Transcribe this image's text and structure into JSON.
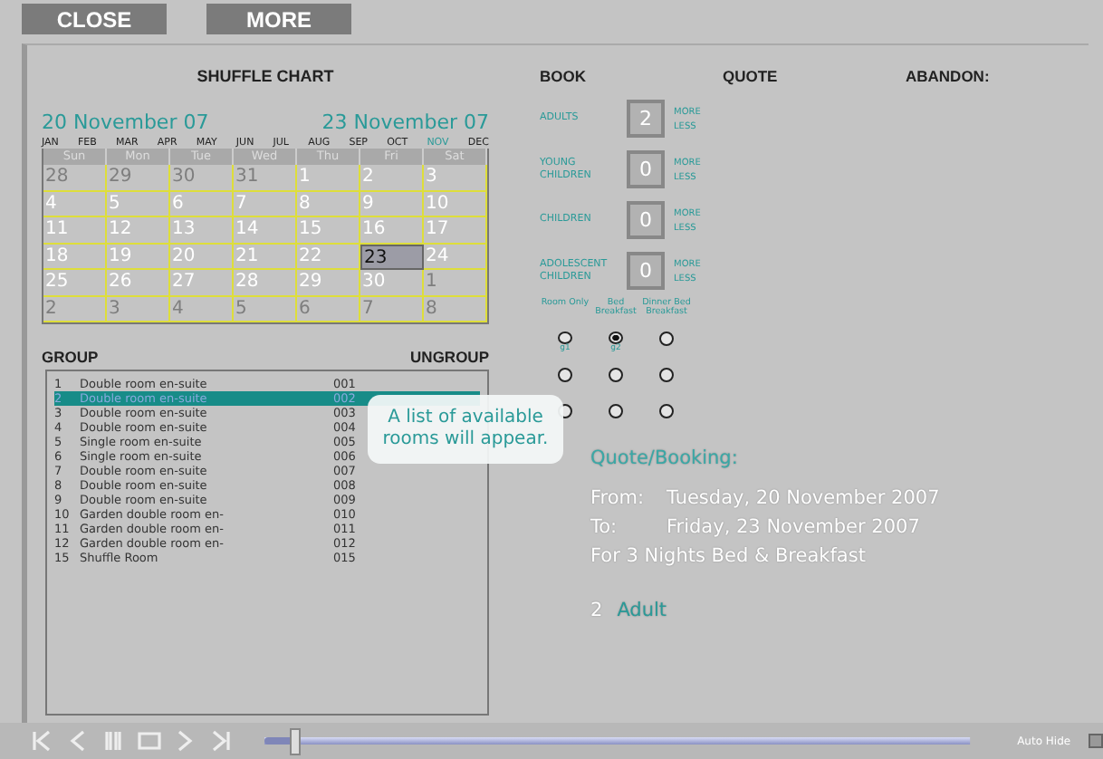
{
  "top_buttons": [
    "CLOSE",
    "MORE"
  ],
  "calendar": {
    "title": "SHUFFLE CHART",
    "from_date": "20 November 07",
    "to_date": "23 November 07",
    "months": [
      {
        "label": "JAN",
        "selected": false
      },
      {
        "label": "FEB",
        "selected": false
      },
      {
        "label": "MAR",
        "selected": false
      },
      {
        "label": "APR",
        "selected": false
      },
      {
        "label": "MAY",
        "selected": false
      },
      {
        "label": "JUN",
        "selected": false
      },
      {
        "label": "JUL",
        "selected": false
      },
      {
        "label": "AUG",
        "selected": false
      },
      {
        "label": "SEP",
        "selected": false
      },
      {
        "label": "OCT",
        "selected": false
      },
      {
        "label": "NOV",
        "selected": true
      },
      {
        "label": "DEC",
        "selected": false
      }
    ],
    "weekdays": [
      "Sun",
      "Mon",
      "Tue",
      "Wed",
      "Thu",
      "Fri",
      "Sat"
    ],
    "weeks": [
      [
        {
          "day": "28",
          "muted": true,
          "selected": false
        },
        {
          "day": "29",
          "muted": true,
          "selected": false
        },
        {
          "day": "30",
          "muted": true,
          "selected": false
        },
        {
          "day": "31",
          "muted": true,
          "selected": false
        },
        {
          "day": "1",
          "muted": false,
          "selected": false
        },
        {
          "day": "2",
          "muted": false,
          "selected": false
        },
        {
          "day": "3",
          "muted": false,
          "selected": false
        }
      ],
      [
        {
          "day": "4",
          "muted": false,
          "selected": false
        },
        {
          "day": "5",
          "muted": false,
          "selected": false
        },
        {
          "day": "6",
          "muted": false,
          "selected": false
        },
        {
          "day": "7",
          "muted": false,
          "selected": false
        },
        {
          "day": "8",
          "muted": false,
          "selected": false
        },
        {
          "day": "9",
          "muted": false,
          "selected": false
        },
        {
          "day": "10",
          "muted": false,
          "selected": false
        }
      ],
      [
        {
          "day": "11",
          "muted": false,
          "selected": false
        },
        {
          "day": "12",
          "muted": false,
          "selected": false
        },
        {
          "day": "13",
          "muted": false,
          "selected": false
        },
        {
          "day": "14",
          "muted": false,
          "selected": false
        },
        {
          "day": "15",
          "muted": false,
          "selected": false
        },
        {
          "day": "16",
          "muted": false,
          "selected": false
        },
        {
          "day": "17",
          "muted": false,
          "selected": false
        }
      ],
      [
        {
          "day": "18",
          "muted": false,
          "selected": false
        },
        {
          "day": "19",
          "muted": false,
          "selected": false
        },
        {
          "day": "20",
          "muted": false,
          "selected": false
        },
        {
          "day": "21",
          "muted": false,
          "selected": false
        },
        {
          "day": "22",
          "muted": false,
          "selected": false
        },
        {
          "day": "23",
          "muted": false,
          "selected": true
        },
        {
          "day": "24",
          "muted": false,
          "selected": false
        }
      ],
      [
        {
          "day": "25",
          "muted": false,
          "selected": false
        },
        {
          "day": "26",
          "muted": false,
          "selected": false
        },
        {
          "day": "27",
          "muted": false,
          "selected": false
        },
        {
          "day": "28",
          "muted": false,
          "selected": false
        },
        {
          "day": "29",
          "muted": false,
          "selected": false
        },
        {
          "day": "30",
          "muted": false,
          "selected": false
        },
        {
          "day": "1",
          "muted": true,
          "selected": false
        }
      ],
      [
        {
          "day": "2",
          "muted": true,
          "selected": false
        },
        {
          "day": "3",
          "muted": true,
          "selected": false
        },
        {
          "day": "4",
          "muted": true,
          "selected": false
        },
        {
          "day": "5",
          "muted": true,
          "selected": false
        },
        {
          "day": "6",
          "muted": true,
          "selected": false
        },
        {
          "day": "7",
          "muted": true,
          "selected": false
        },
        {
          "day": "8",
          "muted": true,
          "selected": false
        }
      ]
    ]
  },
  "actions": [
    "BOOK",
    "QUOTE",
    "ABANDON:"
  ],
  "counters": [
    {
      "label": "ADULTS",
      "value": "2",
      "more": "MORE",
      "less": "LESS"
    },
    {
      "label": "YOUNG CHILDREN",
      "value": "0",
      "more": "MORE",
      "less": "LESS"
    },
    {
      "label": "CHILDREN",
      "value": "0",
      "more": "MORE",
      "less": "LESS"
    },
    {
      "label": "ADOLESCENT CHILDREN",
      "value": "0",
      "more": "MORE",
      "less": "LESS"
    }
  ],
  "board_options": [
    "Room Only",
    "Bed Breakfast",
    "Dinner Bed Breakfast"
  ],
  "board_rows": [
    {
      "options": [
        {
          "selected": false,
          "caption": "g1"
        },
        {
          "selected": true,
          "caption": "g2"
        },
        {
          "selected": false
        }
      ]
    },
    {
      "options": [
        {
          "selected": false
        },
        {
          "selected": false
        },
        {
          "selected": false
        }
      ]
    },
    {
      "options": [
        {
          "selected": false
        },
        {
          "selected": false
        },
        {
          "selected": false
        }
      ]
    }
  ],
  "group_label": "GROUP",
  "ungroup_label": "UNGROUP",
  "rooms": [
    {
      "number": "1",
      "name": "Double room en-suite",
      "code": "001",
      "selected": false
    },
    {
      "number": "2",
      "name": "Double room en-suite",
      "code": "002",
      "selected": true
    },
    {
      "number": "3",
      "name": "Double room en-suite",
      "code": "003",
      "selected": false
    },
    {
      "number": "4",
      "name": "Double room en-suite",
      "code": "004",
      "selected": false
    },
    {
      "number": "5",
      "name": "Single room en-suite",
      "code": "005",
      "selected": false
    },
    {
      "number": "6",
      "name": "Single room en-suite",
      "code": "006",
      "selected": false
    },
    {
      "number": "7",
      "name": "Double room en-suite",
      "code": "007",
      "selected": false
    },
    {
      "number": "8",
      "name": "Double room en-suite",
      "code": "008",
      "selected": false
    },
    {
      "number": "9",
      "name": "Double room en-suite",
      "code": "009",
      "selected": false
    },
    {
      "number": "10",
      "name": "Garden double room en-",
      "code": "010",
      "selected": false
    },
    {
      "number": "11",
      "name": "Garden double room en-",
      "code": "011",
      "selected": false
    },
    {
      "number": "12",
      "name": "Garden double room en-",
      "code": "012",
      "selected": false
    },
    {
      "number": "15",
      "name": "Shuffle Room",
      "code": "015",
      "selected": false
    }
  ],
  "tooltip": "A list of available rooms will appear.",
  "quote": {
    "heading": "Quote/Booking:",
    "from_label": "From:",
    "from_value": "Tuesday, 20 November 2007",
    "to_label": "To:",
    "to_value": "Friday, 23 November 2007",
    "stay": "For 3 Nights Bed & Breakfast",
    "guest_count": "2",
    "guest_type": "Adult"
  },
  "player": {
    "controls": [
      {
        "kind": "first"
      },
      {
        "kind": "prev"
      },
      {
        "kind": "pause"
      },
      {
        "kind": "stop"
      },
      {
        "kind": "next"
      },
      {
        "kind": "last"
      }
    ],
    "progress": {
      "level": 0.04
    },
    "auto_hide": {
      "label": "Auto Hide",
      "checked": false
    }
  }
}
